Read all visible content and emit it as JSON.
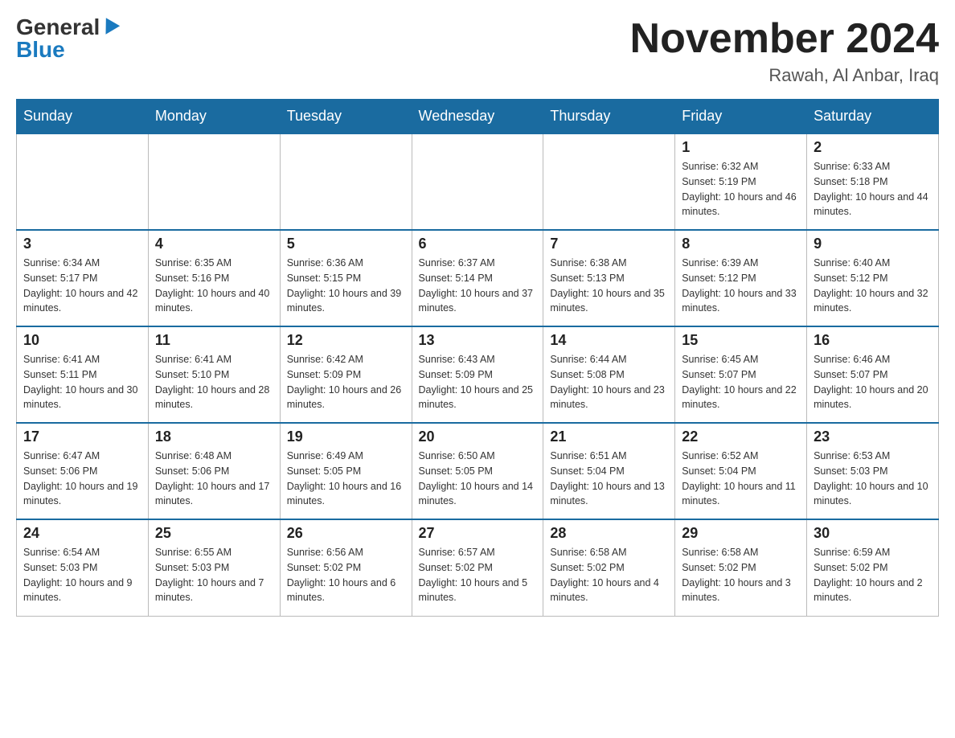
{
  "header": {
    "logo_general": "General",
    "logo_blue": "Blue",
    "title": "November 2024",
    "subtitle": "Rawah, Al Anbar, Iraq"
  },
  "calendar": {
    "days_of_week": [
      "Sunday",
      "Monday",
      "Tuesday",
      "Wednesday",
      "Thursday",
      "Friday",
      "Saturday"
    ],
    "weeks": [
      [
        {
          "day": "",
          "info": ""
        },
        {
          "day": "",
          "info": ""
        },
        {
          "day": "",
          "info": ""
        },
        {
          "day": "",
          "info": ""
        },
        {
          "day": "",
          "info": ""
        },
        {
          "day": "1",
          "info": "Sunrise: 6:32 AM\nSunset: 5:19 PM\nDaylight: 10 hours and 46 minutes."
        },
        {
          "day": "2",
          "info": "Sunrise: 6:33 AM\nSunset: 5:18 PM\nDaylight: 10 hours and 44 minutes."
        }
      ],
      [
        {
          "day": "3",
          "info": "Sunrise: 6:34 AM\nSunset: 5:17 PM\nDaylight: 10 hours and 42 minutes."
        },
        {
          "day": "4",
          "info": "Sunrise: 6:35 AM\nSunset: 5:16 PM\nDaylight: 10 hours and 40 minutes."
        },
        {
          "day": "5",
          "info": "Sunrise: 6:36 AM\nSunset: 5:15 PM\nDaylight: 10 hours and 39 minutes."
        },
        {
          "day": "6",
          "info": "Sunrise: 6:37 AM\nSunset: 5:14 PM\nDaylight: 10 hours and 37 minutes."
        },
        {
          "day": "7",
          "info": "Sunrise: 6:38 AM\nSunset: 5:13 PM\nDaylight: 10 hours and 35 minutes."
        },
        {
          "day": "8",
          "info": "Sunrise: 6:39 AM\nSunset: 5:12 PM\nDaylight: 10 hours and 33 minutes."
        },
        {
          "day": "9",
          "info": "Sunrise: 6:40 AM\nSunset: 5:12 PM\nDaylight: 10 hours and 32 minutes."
        }
      ],
      [
        {
          "day": "10",
          "info": "Sunrise: 6:41 AM\nSunset: 5:11 PM\nDaylight: 10 hours and 30 minutes."
        },
        {
          "day": "11",
          "info": "Sunrise: 6:41 AM\nSunset: 5:10 PM\nDaylight: 10 hours and 28 minutes."
        },
        {
          "day": "12",
          "info": "Sunrise: 6:42 AM\nSunset: 5:09 PM\nDaylight: 10 hours and 26 minutes."
        },
        {
          "day": "13",
          "info": "Sunrise: 6:43 AM\nSunset: 5:09 PM\nDaylight: 10 hours and 25 minutes."
        },
        {
          "day": "14",
          "info": "Sunrise: 6:44 AM\nSunset: 5:08 PM\nDaylight: 10 hours and 23 minutes."
        },
        {
          "day": "15",
          "info": "Sunrise: 6:45 AM\nSunset: 5:07 PM\nDaylight: 10 hours and 22 minutes."
        },
        {
          "day": "16",
          "info": "Sunrise: 6:46 AM\nSunset: 5:07 PM\nDaylight: 10 hours and 20 minutes."
        }
      ],
      [
        {
          "day": "17",
          "info": "Sunrise: 6:47 AM\nSunset: 5:06 PM\nDaylight: 10 hours and 19 minutes."
        },
        {
          "day": "18",
          "info": "Sunrise: 6:48 AM\nSunset: 5:06 PM\nDaylight: 10 hours and 17 minutes."
        },
        {
          "day": "19",
          "info": "Sunrise: 6:49 AM\nSunset: 5:05 PM\nDaylight: 10 hours and 16 minutes."
        },
        {
          "day": "20",
          "info": "Sunrise: 6:50 AM\nSunset: 5:05 PM\nDaylight: 10 hours and 14 minutes."
        },
        {
          "day": "21",
          "info": "Sunrise: 6:51 AM\nSunset: 5:04 PM\nDaylight: 10 hours and 13 minutes."
        },
        {
          "day": "22",
          "info": "Sunrise: 6:52 AM\nSunset: 5:04 PM\nDaylight: 10 hours and 11 minutes."
        },
        {
          "day": "23",
          "info": "Sunrise: 6:53 AM\nSunset: 5:03 PM\nDaylight: 10 hours and 10 minutes."
        }
      ],
      [
        {
          "day": "24",
          "info": "Sunrise: 6:54 AM\nSunset: 5:03 PM\nDaylight: 10 hours and 9 minutes."
        },
        {
          "day": "25",
          "info": "Sunrise: 6:55 AM\nSunset: 5:03 PM\nDaylight: 10 hours and 7 minutes."
        },
        {
          "day": "26",
          "info": "Sunrise: 6:56 AM\nSunset: 5:02 PM\nDaylight: 10 hours and 6 minutes."
        },
        {
          "day": "27",
          "info": "Sunrise: 6:57 AM\nSunset: 5:02 PM\nDaylight: 10 hours and 5 minutes."
        },
        {
          "day": "28",
          "info": "Sunrise: 6:58 AM\nSunset: 5:02 PM\nDaylight: 10 hours and 4 minutes."
        },
        {
          "day": "29",
          "info": "Sunrise: 6:58 AM\nSunset: 5:02 PM\nDaylight: 10 hours and 3 minutes."
        },
        {
          "day": "30",
          "info": "Sunrise: 6:59 AM\nSunset: 5:02 PM\nDaylight: 10 hours and 2 minutes."
        }
      ]
    ]
  }
}
